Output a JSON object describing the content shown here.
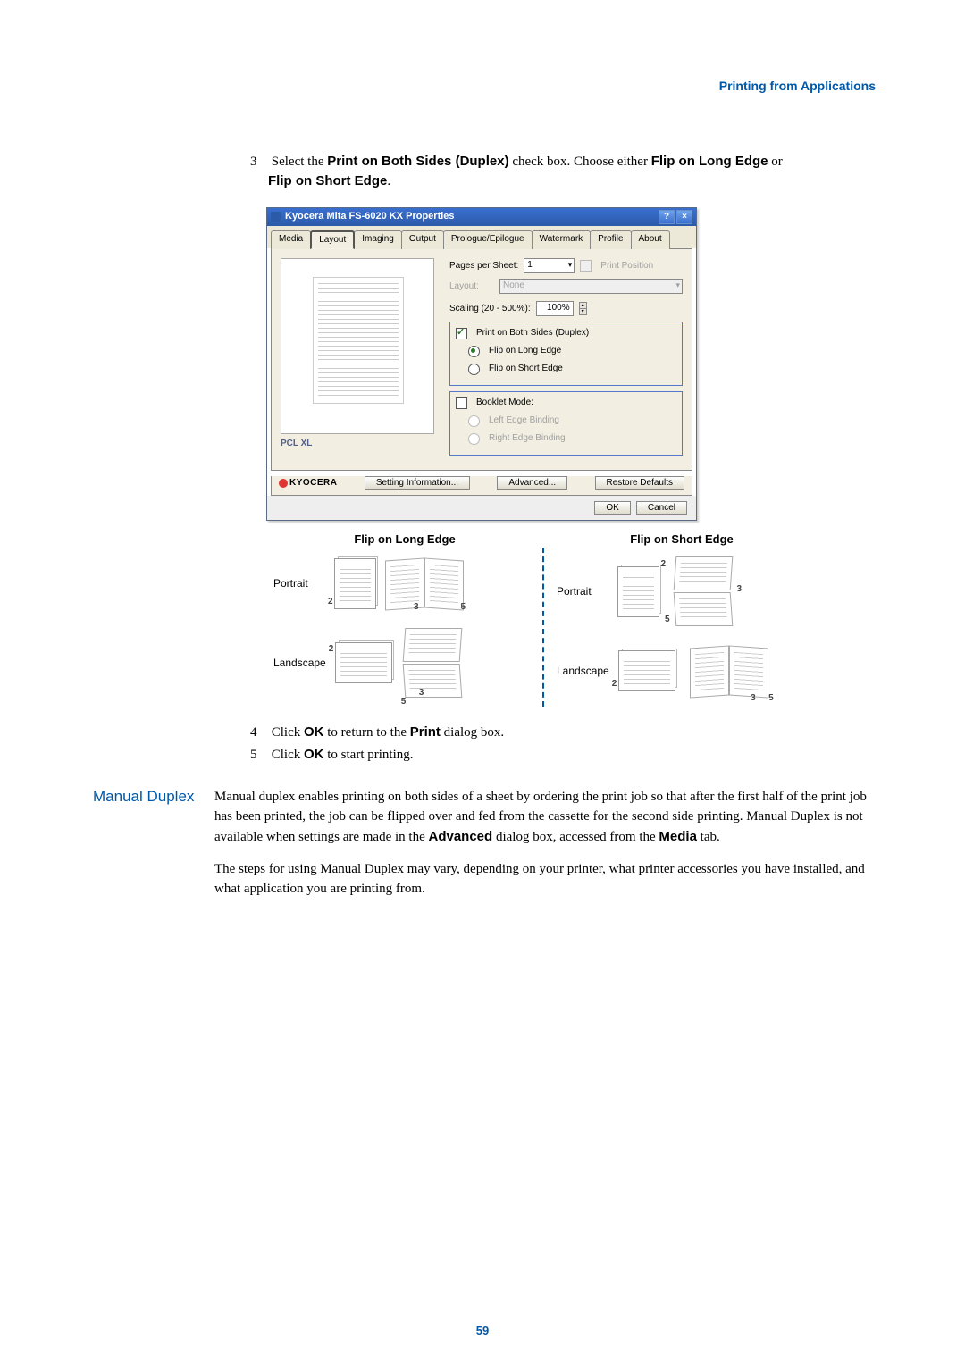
{
  "header": {
    "link_text": "Printing from Applications"
  },
  "step3": {
    "num": "3",
    "prefix": "Select the ",
    "bold1": "Print on Both Sides (Duplex)",
    "mid": " check box. Choose either ",
    "bold2": "Flip on Long Edge",
    "mid2": " or ",
    "bold3": "Flip on Short Edge",
    "suffix": "."
  },
  "dialog": {
    "title": "Kyocera Mita FS-6020 KX Properties",
    "help_btn": "?",
    "close_btn": "×",
    "tabs": [
      "Media",
      "Layout",
      "Imaging",
      "Output",
      "Prologue/Epilogue",
      "Watermark",
      "Profile",
      "About"
    ],
    "active_tab": "Layout",
    "pages_per_sheet_label": "Pages per Sheet:",
    "pages_per_sheet_value": "1",
    "print_position_label": "Print Position",
    "layout_label": "Layout:",
    "layout_value": "None",
    "scaling_label": "Scaling (20 - 500%):",
    "scaling_value": "100%",
    "duplex_check": "Print on Both Sides (Duplex)",
    "flip_long": "Flip on Long Edge",
    "flip_short": "Flip on Short Edge",
    "booklet_label": "Booklet Mode:",
    "left_binding": "Left Edge Binding",
    "right_binding": "Right Edge Binding",
    "pcl_label": "PCL XL",
    "brand": "KYOCERA",
    "setting_info": "Setting Information...",
    "advanced_btn": "Advanced...",
    "restore_btn": "Restore Defaults",
    "ok_btn": "OK",
    "cancel_btn": "Cancel"
  },
  "fig": {
    "header_long": "Flip on Long Edge",
    "header_short": "Flip on Short Edge",
    "portrait": "Portrait",
    "landscape": "Landscape",
    "n2": "2",
    "n3": "3",
    "n5": "5"
  },
  "step4": {
    "num": "4",
    "prefix": "Click ",
    "bold": "OK",
    "mid": " to return to the ",
    "bold2": "Print",
    "suffix": " dialog box."
  },
  "step5": {
    "num": "5",
    "prefix": "Click ",
    "bold": "OK",
    "suffix": " to start printing."
  },
  "manual_duplex": {
    "title": "Manual Duplex",
    "p1a": "Manual duplex enables printing on both sides of a sheet by ordering the print job so that after the first half of the print job has been printed, the job can be flipped over and fed from the cassette for the second side printing. Manual Duplex is not available when settings are made in the ",
    "bold1": "Advanced",
    "p1b": " dialog box, accessed from the ",
    "bold2": "Media",
    "p1c": " tab.",
    "p2": "The steps for using Manual Duplex may vary, depending on your printer, what printer accessories you have installed, and what application you are printing from."
  },
  "page_number": "59"
}
